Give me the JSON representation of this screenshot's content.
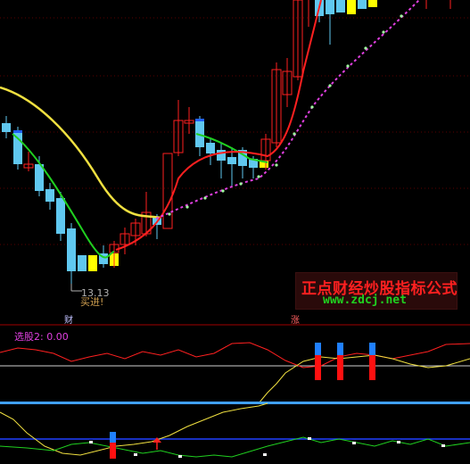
{
  "watermark": {
    "title": "正点财经炒股指标公式",
    "url": "www.zdcj.net"
  },
  "main_panel": {
    "low_price_label": "13.13",
    "buy_label": "买进!",
    "marker_left": "财",
    "marker_right": "涨"
  },
  "indicator_panel": {
    "label": "选股2: 0.00"
  },
  "colors": {
    "background": "#000000",
    "candle_down": "#60c8f0",
    "candle_up": "#ff2020",
    "candle_yellow": "#ffff00",
    "ma_long": "#f0e040",
    "ma_green": "#20d020",
    "ma_red": "#ff2020",
    "ma_magenta": "#e040e0",
    "divider": "#40a0ff"
  }
}
